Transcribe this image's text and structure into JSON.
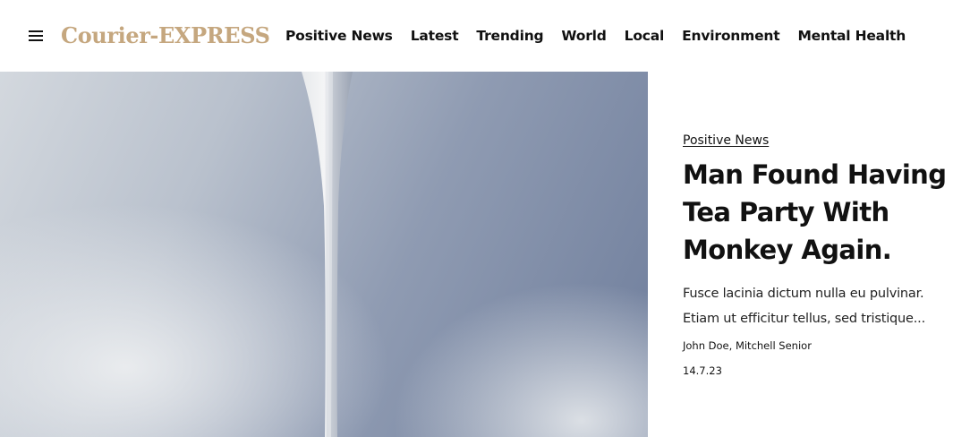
{
  "header": {
    "logo_text": "Courier-EXPRESS",
    "nav": [
      {
        "label": "Positive News"
      },
      {
        "label": "Latest"
      },
      {
        "label": "Trending"
      },
      {
        "label": "World"
      },
      {
        "label": "Local"
      },
      {
        "label": "Environment"
      },
      {
        "label": "Mental Health"
      }
    ]
  },
  "icons": {
    "menu": "hamburger-menu-icon"
  },
  "colors": {
    "logo": "#c5a77f",
    "text": "#111111",
    "background": "#ffffff"
  },
  "article": {
    "category": "Positive News",
    "headline": "Man Found Having Tea Party With Monkey Again.",
    "excerpt": "Fusce lacinia dictum nulla eu pulvinar. Etiam ut efficitur tellus, sed tristique...",
    "authors": "John Doe, Mitchell Senior",
    "date": "14.7.23"
  }
}
